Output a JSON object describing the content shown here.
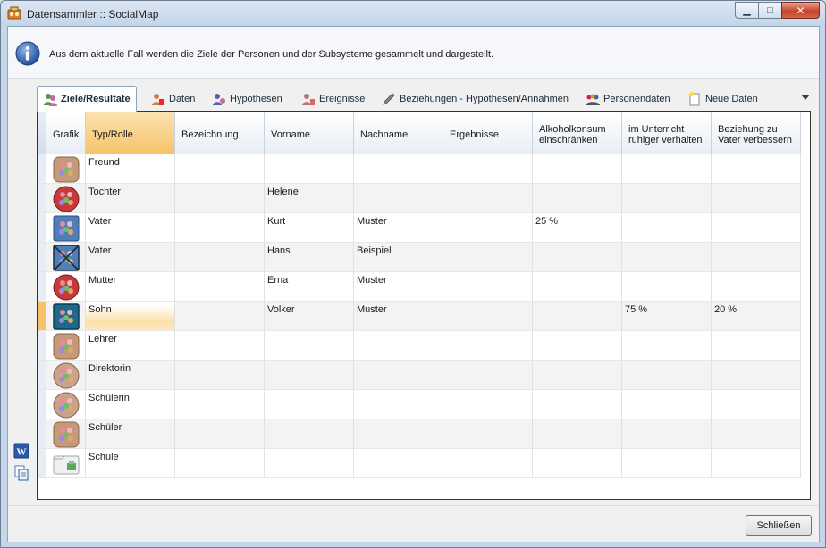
{
  "window": {
    "title": "Datensammler :: SocialMap"
  },
  "info": {
    "text": "Aus dem aktuelle Fall werden die Ziele der Personen und der Subsysteme gesammelt und dargestellt."
  },
  "tabs": [
    {
      "label": "Ziele/Resultate",
      "icon": "persons-goal-icon",
      "active": true
    },
    {
      "label": "Daten",
      "icon": "person-data-icon"
    },
    {
      "label": "Hypothesen",
      "icon": "person-hypothesis-icon"
    },
    {
      "label": "Ereignisse",
      "icon": "person-event-icon"
    },
    {
      "label": "Beziehungen - Hypothesen/Annahmen",
      "icon": "brush-icon"
    },
    {
      "label": "Personendaten",
      "icon": "group-icon"
    },
    {
      "label": "Neue Daten",
      "icon": "new-document-icon"
    }
  ],
  "table": {
    "columns": [
      "Grafik",
      "Typ/Rolle",
      "Bezeichnung",
      "Vorname",
      "Nachname",
      "Ergebnisse",
      "Alkoholkonsum einschränken",
      "im Unterricht ruhiger verhalten",
      "Beziehung zu Vater verbessern"
    ],
    "rows": [
      {
        "icon": "rounded-square-tan",
        "typ": "Freund",
        "bezeichnung": "",
        "vorname": "",
        "nachname": "",
        "ergebnisse": "",
        "alkohol": "",
        "unterricht": "",
        "vater": ""
      },
      {
        "icon": "circle-red",
        "typ": "Tochter",
        "bezeichnung": "",
        "vorname": "Helene",
        "nachname": "",
        "ergebnisse": "",
        "alkohol": "",
        "unterricht": "",
        "vater": ""
      },
      {
        "icon": "square-blue",
        "typ": "Vater",
        "bezeichnung": "",
        "vorname": "Kurt",
        "nachname": "Muster",
        "ergebnisse": "",
        "alkohol": "25 %",
        "unterricht": "",
        "vater": ""
      },
      {
        "icon": "square-blue-crossed",
        "typ": "Vater",
        "bezeichnung": "",
        "vorname": "Hans",
        "nachname": "Beispiel",
        "ergebnisse": "",
        "alkohol": "",
        "unterricht": "",
        "vater": ""
      },
      {
        "icon": "circle-red",
        "typ": "Mutter",
        "bezeichnung": "",
        "vorname": "Erna",
        "nachname": "Muster",
        "ergebnisse": "",
        "alkohol": "",
        "unterricht": "",
        "vater": ""
      },
      {
        "icon": "square-teal",
        "typ": "Sohn",
        "bezeichnung": "",
        "vorname": "Volker",
        "nachname": "Muster",
        "ergebnisse": "",
        "alkohol": "",
        "unterricht": "75 %",
        "vater": "20 %",
        "current": true
      },
      {
        "icon": "rounded-square-tan",
        "typ": "Lehrer",
        "bezeichnung": "",
        "vorname": "",
        "nachname": "",
        "ergebnisse": "",
        "alkohol": "",
        "unterricht": "",
        "vater": ""
      },
      {
        "icon": "circle-tan",
        "typ": "Direktorin",
        "bezeichnung": "",
        "vorname": "",
        "nachname": "",
        "ergebnisse": "",
        "alkohol": "",
        "unterricht": "",
        "vater": ""
      },
      {
        "icon": "circle-tan",
        "typ": "Schülerin",
        "bezeichnung": "",
        "vorname": "",
        "nachname": "",
        "ergebnisse": "",
        "alkohol": "",
        "unterricht": "",
        "vater": ""
      },
      {
        "icon": "rounded-square-tan",
        "typ": "Schüler",
        "bezeichnung": "",
        "vorname": "",
        "nachname": "",
        "ergebnisse": "",
        "alkohol": "",
        "unterricht": "",
        "vater": ""
      },
      {
        "icon": "folder-school",
        "typ": "Schule",
        "bezeichnung": "",
        "vorname": "",
        "nachname": "",
        "ergebnisse": "",
        "alkohol": "",
        "unterricht": "",
        "vater": ""
      }
    ]
  },
  "side_icons": [
    "word-export-icon",
    "copy-document-icon"
  ],
  "footer": {
    "close_label": "Schließen"
  },
  "colors": {
    "accent_header": "#f6c36a",
    "titlebar": "#c4d5e9",
    "close": "#c7432b"
  }
}
